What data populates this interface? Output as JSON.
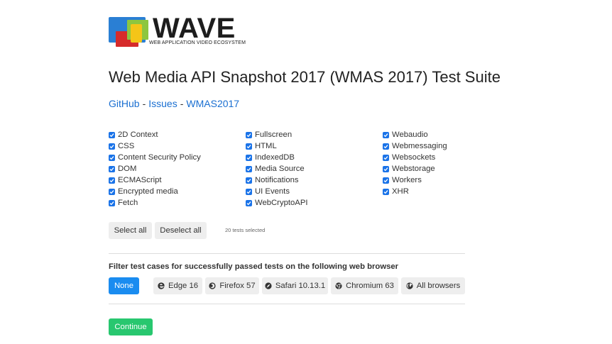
{
  "logo": {
    "title": "WAVE",
    "subtitle": "WEB APPLICATION VIDEO ECOSYSTEM",
    "colors": {
      "blue": "#2a7fd4",
      "green": "#8dc63f",
      "yellow": "#f5c518",
      "red": "#d62b2b"
    }
  },
  "page": {
    "title": "Web Media API Snapshot 2017 (WMAS 2017) Test Suite"
  },
  "links": [
    {
      "label": "GitHub"
    },
    {
      "label": "Issues"
    },
    {
      "label": "WMAS2017"
    }
  ],
  "link_separator": "-",
  "tests": {
    "col1": [
      {
        "label": "2D Context",
        "checked": true
      },
      {
        "label": "CSS",
        "checked": true
      },
      {
        "label": "Content Security Policy",
        "checked": true
      },
      {
        "label": "DOM",
        "checked": true
      },
      {
        "label": "ECMAScript",
        "checked": true
      },
      {
        "label": "Encrypted media",
        "checked": true
      },
      {
        "label": "Fetch",
        "checked": true
      }
    ],
    "col2": [
      {
        "label": "Fullscreen",
        "checked": true
      },
      {
        "label": "HTML",
        "checked": true
      },
      {
        "label": "IndexedDB",
        "checked": true
      },
      {
        "label": "Media Source",
        "checked": true
      },
      {
        "label": "Notifications",
        "checked": true
      },
      {
        "label": "UI Events",
        "checked": true
      },
      {
        "label": "WebCryptoAPI",
        "checked": true
      }
    ],
    "col3": [
      {
        "label": "Webaudio",
        "checked": true
      },
      {
        "label": "Webmessaging",
        "checked": true
      },
      {
        "label": "Websockets",
        "checked": true
      },
      {
        "label": "Webstorage",
        "checked": true
      },
      {
        "label": "Workers",
        "checked": true
      },
      {
        "label": "XHR",
        "checked": true
      }
    ]
  },
  "selection": {
    "select_all": "Select all",
    "deselect_all": "Deselect all",
    "count_text": "20 tests selected"
  },
  "filter": {
    "label": "Filter test cases for successfully passed tests on the following web browser",
    "browsers": [
      {
        "label": "None",
        "icon": null,
        "active": true
      },
      {
        "label": "Edge 16",
        "icon": "edge-icon",
        "active": false
      },
      {
        "label": "Firefox 57",
        "icon": "firefox-icon",
        "active": false
      },
      {
        "label": "Safari 10.13.1",
        "icon": "safari-icon",
        "active": false
      },
      {
        "label": "Chromium 63",
        "icon": "chromium-icon",
        "active": false
      },
      {
        "label": "All browsers",
        "icon": "globe-icon",
        "active": false
      }
    ]
  },
  "actions": {
    "continue": "Continue"
  },
  "colors": {
    "link": "#1a6fd1",
    "checkbox": "#1a73e8",
    "primary": "#1a8cf0",
    "success": "#28c76f"
  }
}
